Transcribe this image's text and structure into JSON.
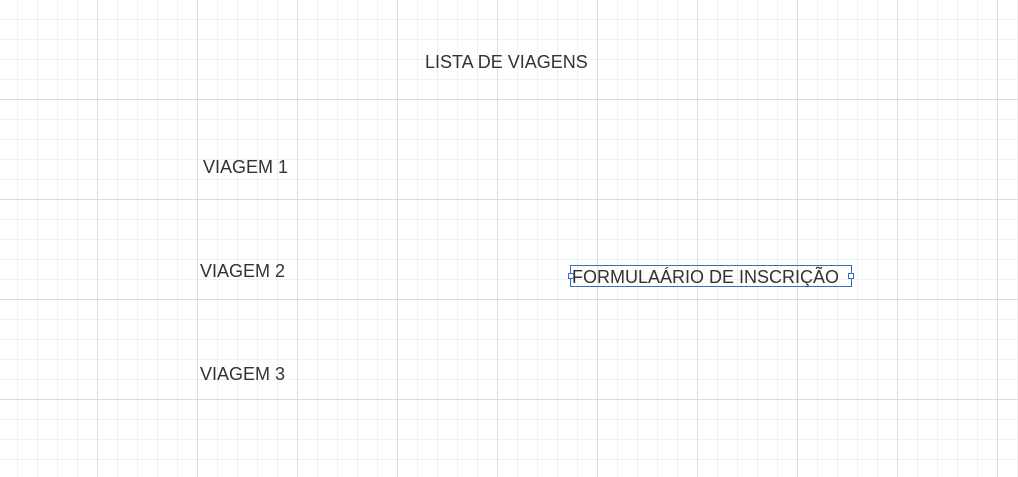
{
  "diagram": {
    "title": "LISTA DE VIAGENS",
    "trips": [
      "VIAGEM 1",
      "VIAGEM 2",
      "VIAGEM 3"
    ],
    "form_label": "FORMULAÁRIO DE INSCRIÇÃO"
  },
  "colors": {
    "text": "#333333",
    "selection": "#3b6cc4",
    "grid_major": "#dcdcdc",
    "grid_minor": "#f0f0f0"
  }
}
